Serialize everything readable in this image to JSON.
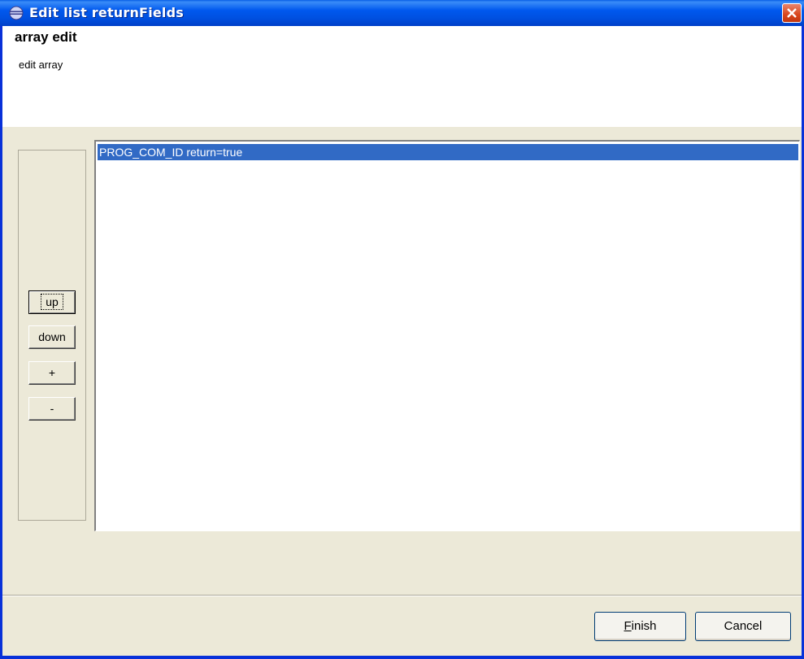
{
  "window": {
    "title": "Edit list returnFields"
  },
  "header": {
    "title": "array edit",
    "description": "edit array"
  },
  "buttons": {
    "up": "up",
    "down": "down",
    "add": "+",
    "remove": "-"
  },
  "list": {
    "items": [
      "PROG_COM_ID return=true"
    ],
    "selected_index": 0
  },
  "footer": {
    "finish_prefix": "F",
    "finish_rest": "inish",
    "cancel": "Cancel"
  },
  "colors": {
    "selection": "#316ac5",
    "titlebar": "#0058ee",
    "dialog_background": "#ece9d8"
  }
}
